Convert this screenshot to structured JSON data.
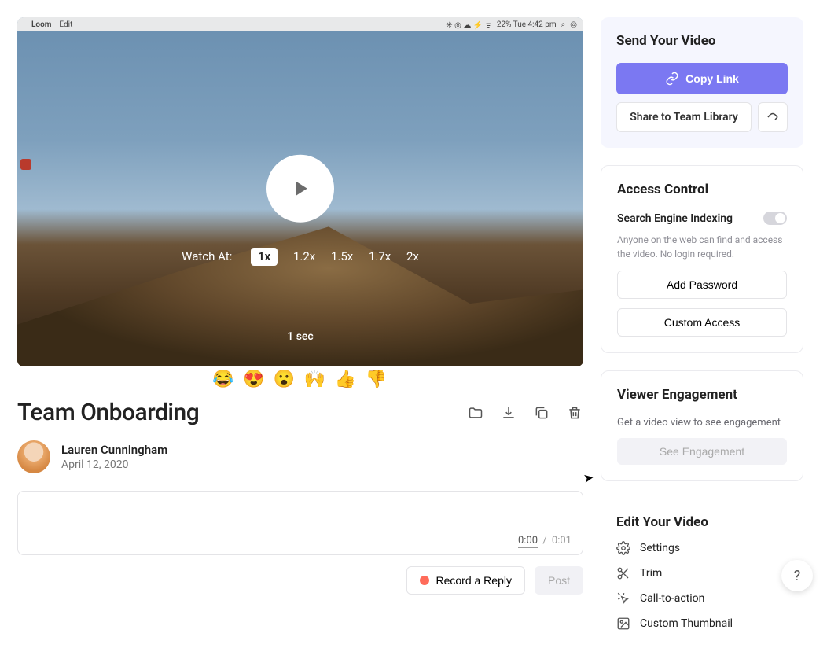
{
  "menubar": {
    "apple": "",
    "items": [
      "Loom",
      "Edit"
    ],
    "right": "22%  Tue 4:42 pm"
  },
  "player": {
    "watch_at_label": "Watch At:",
    "speeds": [
      "1x",
      "1.2x",
      "1.5x",
      "1.7x",
      "2x"
    ],
    "selected_speed": "1x",
    "duration_label": "1 sec"
  },
  "reactions": [
    "😂",
    "😍",
    "😮",
    "🙌",
    "👍",
    "👎"
  ],
  "title": "Team Onboarding",
  "author": {
    "name": "Lauren Cunningham",
    "date": "April 12, 2020"
  },
  "comment": {
    "current": "0:00",
    "sep": "/",
    "total": "0:01"
  },
  "reply": {
    "record_label": "Record a Reply",
    "post_label": "Post"
  },
  "send": {
    "title": "Send Your Video",
    "copy_link": "Copy Link",
    "share_team": "Share to Team Library"
  },
  "access": {
    "title": "Access Control",
    "toggle_label": "Search Engine Indexing",
    "helper": "Anyone on the web can find and access the video. No login required.",
    "add_password": "Add Password",
    "custom_access": "Custom Access"
  },
  "engagement": {
    "title": "Viewer Engagement",
    "helper": "Get a video view to see engagement",
    "button": "See Engagement"
  },
  "edit": {
    "title": "Edit Your Video",
    "settings": "Settings",
    "trim": "Trim",
    "cta": "Call-to-action",
    "thumbnail": "Custom Thumbnail"
  }
}
